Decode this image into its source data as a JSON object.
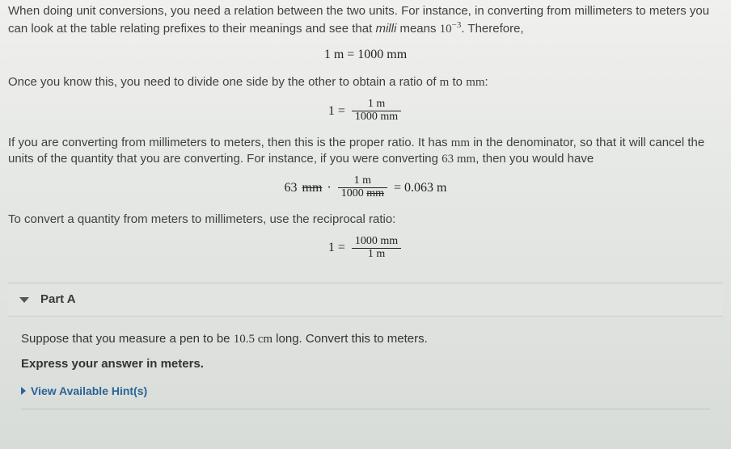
{
  "intro": {
    "p1a": "When doing unit conversions, you need a relation between the two units. For instance, in converting from millimeters to meters you can look at the table relating prefixes to their meanings and see that ",
    "p1_italic": "milli",
    "p1b": " means ",
    "p1_exp_base": "10",
    "p1_exp_pow": "−3",
    "p1c": ". Therefore,",
    "eq1": "1 m = 1000 mm",
    "p2a": "Once you know this, you need to divide one side by the other to obtain a ratio of ",
    "p2_m": "m",
    "p2_to": " to ",
    "p2_mm": "mm",
    "p2b": ":",
    "eq2_lhs": "1 =",
    "eq2_num": "1 m",
    "eq2_den": "1000 mm",
    "p3a": "If you are converting from millimeters to meters, then this is the proper ratio. It has ",
    "p3_mm": "mm",
    "p3b": " in the denominator, so that it will cancel the units of the quantity that you are converting. For instance, if you were converting ",
    "p3_val": "63 mm",
    "p3c": ", then you would have",
    "eq3_left_val": "63 ",
    "eq3_left_unit": "mm",
    "eq3_dot": "·",
    "eq3_num_a": "1 m",
    "eq3_den_a": "1000 ",
    "eq3_den_unit": "mm",
    "eq3_eq": "= 0.063 m",
    "p4": "To convert a quantity from meters to millimeters, use the reciprocal ratio:",
    "eq4_lhs": "1 =",
    "eq4_num": "1000 mm",
    "eq4_den": "1 m"
  },
  "partA": {
    "label": "Part A",
    "prompt_a": "Suppose that you measure a pen to be ",
    "prompt_val": "10.5 cm",
    "prompt_b": " long. Convert this to meters.",
    "instruct": "Express your answer in meters.",
    "hints": "View Available Hint(s)"
  }
}
